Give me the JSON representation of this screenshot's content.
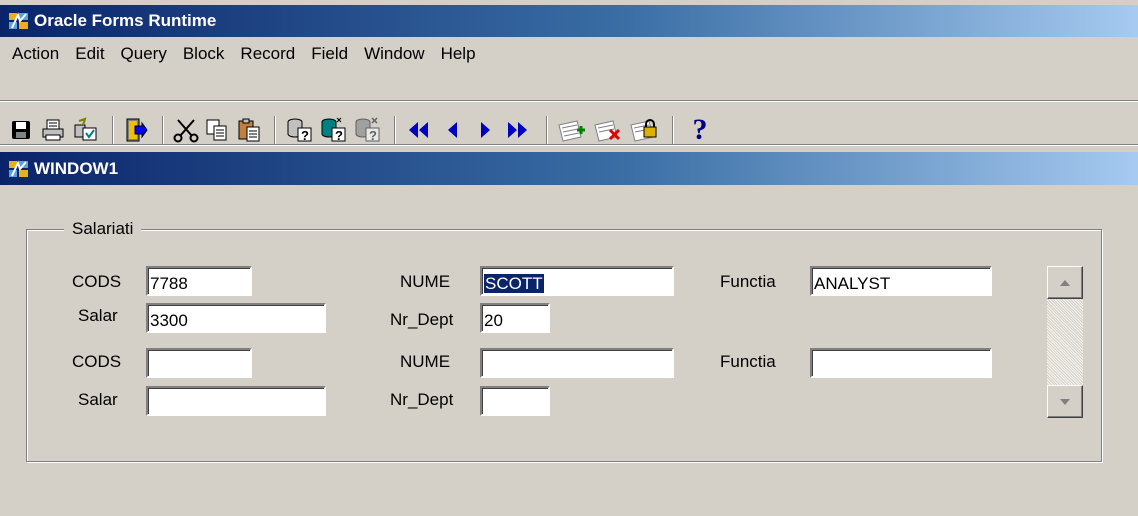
{
  "app": {
    "title": "Oracle Forms Runtime"
  },
  "menu": [
    "Action",
    "Edit",
    "Query",
    "Block",
    "Record",
    "Field",
    "Window",
    "Help"
  ],
  "toolbar": {
    "buttons": [
      "save-icon",
      "print-icon",
      "clear-form-icon",
      "exit-icon",
      "cut-icon",
      "copy-icon",
      "paste-icon",
      "enter-query-icon",
      "execute-query-icon",
      "cancel-query-icon",
      "previous-block-icon",
      "previous-record-icon",
      "next-record-icon",
      "next-block-icon",
      "insert-record-icon",
      "delete-record-icon",
      "lock-record-icon",
      "help-icon"
    ],
    "help_glyph": "?"
  },
  "window": {
    "title": "WINDOW1"
  },
  "frame": {
    "title": "Salariati"
  },
  "labels": {
    "cods": "CODS",
    "salar": "Salar",
    "nume": "NUME",
    "nr_dept": "Nr_Dept",
    "functia": "Functia"
  },
  "records": [
    {
      "cods": "7788",
      "salar": "3300",
      "nume": "SCOTT",
      "nr_dept": "20",
      "functia": "ANALYST"
    },
    {
      "cods": "",
      "salar": "",
      "nume": "",
      "nr_dept": "",
      "functia": ""
    }
  ],
  "colors": {
    "title_gradient_start": "#0a246a",
    "title_gradient_end": "#a6caf0",
    "dialog_background": "#d4d0c8",
    "selection": "#0a246a"
  }
}
